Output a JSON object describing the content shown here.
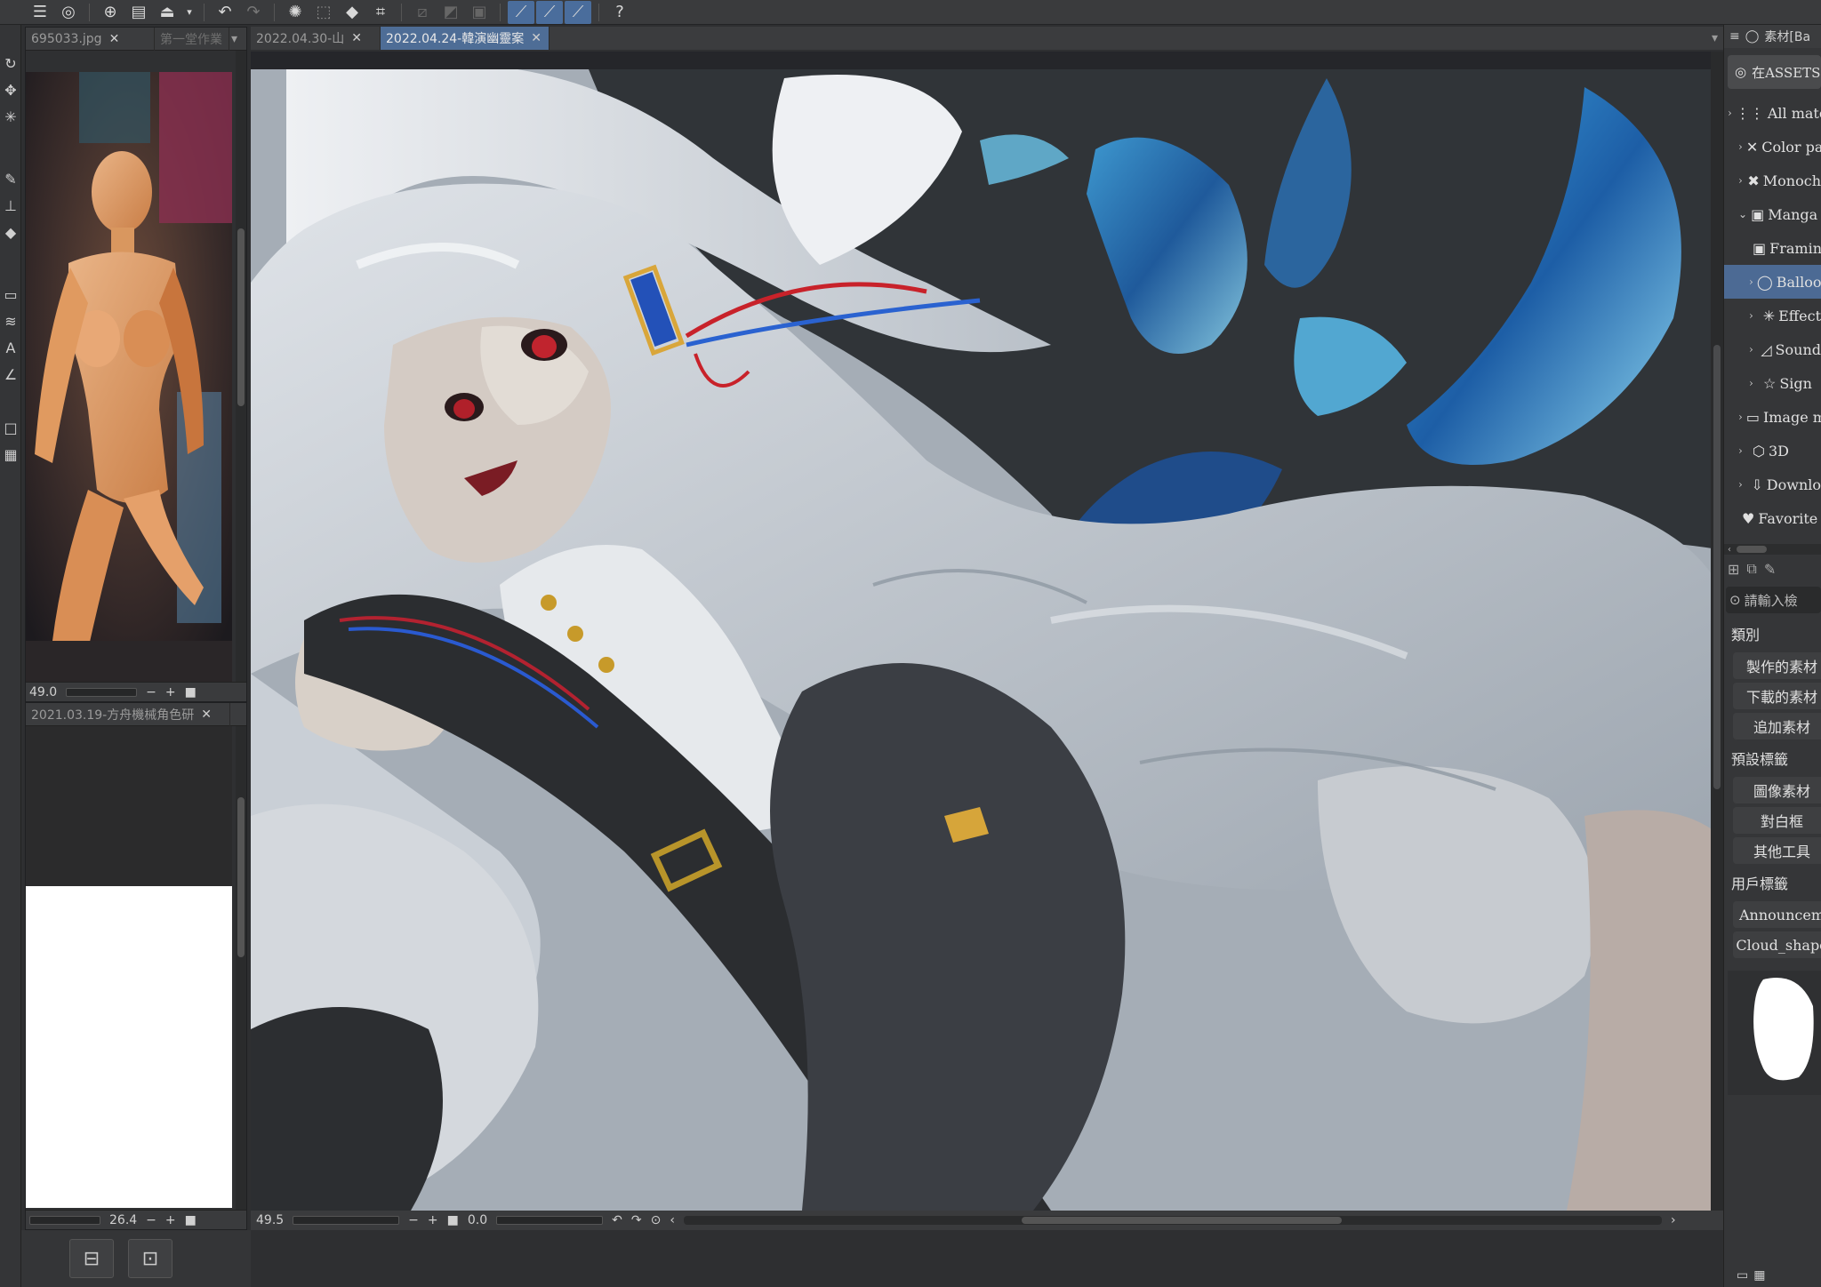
{
  "toolbar": {
    "icons": [
      "menu-icon",
      "assets-icon",
      "new-file-icon",
      "open-folder-icon",
      "save-icon",
      "dropdown-icon",
      "undo-icon",
      "redo-icon",
      "spinner-icon",
      "selection-icon",
      "fill-icon",
      "transform-icon",
      "ruler-icon",
      "ruler2-icon",
      "ruler3-icon",
      "pen-stabilizer-icon",
      "pen-pressure-icon",
      "pen-angle-icon",
      "help-icon"
    ]
  },
  "subview_top": {
    "tabs": [
      {
        "label": "695033.jpg"
      },
      {
        "label": "第一堂作業"
      }
    ],
    "zoom": "49.0"
  },
  "subview_bottom": {
    "tab": {
      "label": "2021.03.19-方舟機械角色研"
    },
    "zoom": "26.4"
  },
  "canvas": {
    "tabs": [
      {
        "label": "2022.04.30-山"
      },
      {
        "label": "2022.04.24-韓演幽靈案",
        "active": true
      }
    ],
    "zoom": "49.5",
    "rotation": "0.0"
  },
  "right_panel": {
    "header": "素材[Ba",
    "assets_button": "在ASSETS",
    "tree": [
      {
        "label": "All materi",
        "indent": 0,
        "icon": "grid-icon"
      },
      {
        "label": "Color pa",
        "indent": 1,
        "icon": "palette-icon"
      },
      {
        "label": "Monoch",
        "indent": 1,
        "icon": "mono-icon"
      },
      {
        "label": "Manga m",
        "indent": 1,
        "icon": "manga-icon",
        "expanded": true
      },
      {
        "label": "Framin",
        "indent": 2,
        "icon": "frame-icon"
      },
      {
        "label": "Balloo",
        "indent": 2,
        "icon": "balloon-icon",
        "selected": true
      },
      {
        "label": "Effect",
        "indent": 2,
        "icon": "effect-icon"
      },
      {
        "label": "Sound",
        "indent": 2,
        "icon": "sound-icon"
      },
      {
        "label": "Sign",
        "indent": 2,
        "icon": "sign-icon"
      },
      {
        "label": "Image m",
        "indent": 1,
        "icon": "image-icon"
      },
      {
        "label": "3D",
        "indent": 1,
        "icon": "cube-icon"
      },
      {
        "label": "Downlo",
        "indent": 1,
        "icon": "download-icon"
      },
      {
        "label": "Favorite",
        "indent": 0,
        "icon": "heart-icon"
      }
    ],
    "search_placeholder": "請輸入檢",
    "section_category": "類別",
    "category_tags": [
      "製作的素材",
      "下載的素材",
      "追加素材"
    ],
    "section_preset": "預設標籤",
    "preset_tags": [
      "圖像素材",
      "對白框",
      "其他工具"
    ],
    "section_user": "用戶標籤",
    "user_tags": [
      "Announcem",
      "Cloud_shape"
    ]
  },
  "colors": {
    "accent": "#4e6d96",
    "canvas_bg": "#25262a"
  }
}
